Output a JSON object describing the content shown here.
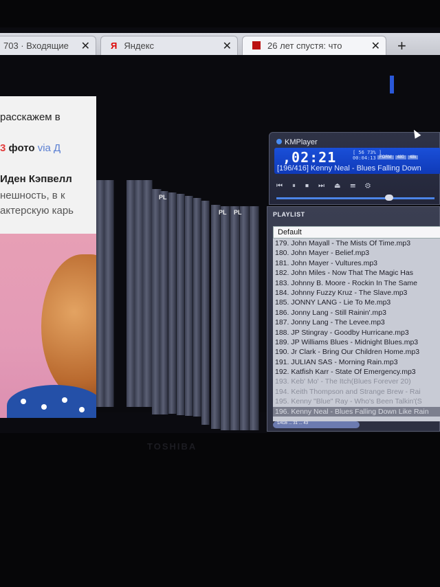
{
  "browser": {
    "tabs": [
      {
        "label": "703 · Входящие",
        "close": "✕"
      },
      {
        "label": "Яндекс",
        "close": "✕",
        "icon": "Я"
      },
      {
        "label": "26 лет спустя: что",
        "close": "✕"
      }
    ],
    "new_tab": "+"
  },
  "article": {
    "line1": "расскажем в",
    "photo_count": "3",
    "photo_word": "фото",
    "via": "via Д",
    "author": "Иден Кэпвелл",
    "line4": "нешность, в к",
    "line5": "актерскую карь"
  },
  "ghost_windows": {
    "labels": [
      "PL",
      "PL",
      "PL"
    ]
  },
  "kmplayer": {
    "title": "KMPlayer",
    "time": "02:21",
    "sub1": "[ 56 73% ]",
    "sub2": "00:04:13",
    "chips": [
      "FORM",
      "480",
      "48k"
    ],
    "track": "[196/416] Kenny Neal - Blues Falling Down",
    "controls": [
      "⏮",
      "⏸",
      "⏹",
      "⏭",
      "⏏",
      "☰",
      "⚙"
    ]
  },
  "playlist": {
    "header": "PLAYLIST",
    "selected_list": "Default",
    "items": [
      {
        "text": "179. John Mayall - The Mists Of Time.mp3",
        "state": "normal"
      },
      {
        "text": "180. John Mayer - Belief.mp3",
        "state": "normal"
      },
      {
        "text": "181. John Mayer - Vultures.mp3",
        "state": "normal"
      },
      {
        "text": "182. John Miles - Now That The Magic Has",
        "state": "normal"
      },
      {
        "text": "183. Johnny B. Moore - Rockin In The Same",
        "state": "normal"
      },
      {
        "text": "184. Johnny Fuzzy Kruz - The Slave.mp3",
        "state": "normal"
      },
      {
        "text": "185. JONNY LANG - Lie To Me.mp3",
        "state": "normal"
      },
      {
        "text": "186. Jonny Lang - Still Rainin'.mp3",
        "state": "normal"
      },
      {
        "text": "187. Jonny Lang - The Levee.mp3",
        "state": "normal"
      },
      {
        "text": "188. JP Stingray - Goodby Hurricane.mp3",
        "state": "normal"
      },
      {
        "text": "189. JP Williams Blues - Midnight Blues.mp3",
        "state": "normal"
      },
      {
        "text": "190. Jr Clark - Bring Our Children Home.mp3",
        "state": "normal"
      },
      {
        "text": "191. JULIAN SAS - Morning Rain.mp3",
        "state": "normal"
      },
      {
        "text": "192. Katfish Karr - State Of Emergency.mp3",
        "state": "normal"
      },
      {
        "text": "193. Keb' Mo' - The Itch(Blues Forever 20)",
        "state": "dim"
      },
      {
        "text": "194. Keith Thompson and Strange Brew - Rai",
        "state": "dim"
      },
      {
        "text": "195. Kenny \"Blue\" Ray - Who's Been Talkin'(S",
        "state": "dim"
      },
      {
        "text": "196. Kenny Neal - Blues Falling Down Like Rain",
        "state": "sel"
      }
    ],
    "footer": "1/416 ... 31 ... 43"
  },
  "monitor_brand": "TOSHIBA"
}
